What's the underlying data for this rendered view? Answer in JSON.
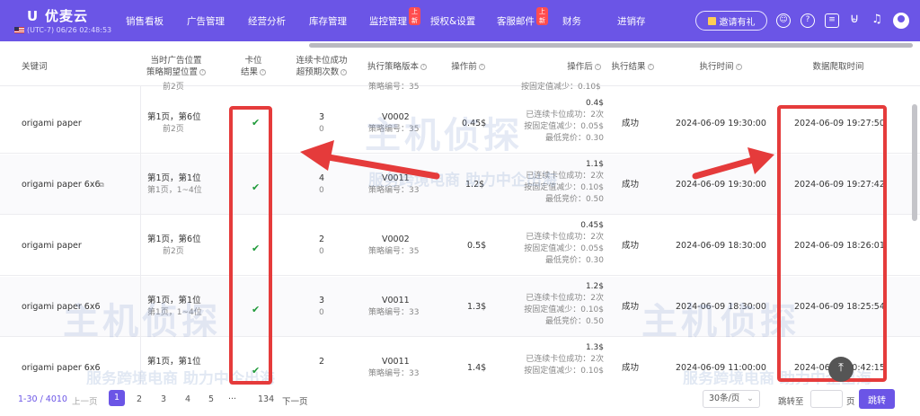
{
  "brand": {
    "name": "优麦云",
    "timezone": "(UTC-7) 06/26 02:48:53"
  },
  "nav": {
    "items": [
      "销售看板",
      "广告管理",
      "经营分析",
      "库存管理",
      "监控管理",
      "授权&设置",
      "客服邮件",
      "财务",
      "进销存"
    ],
    "badge_new": "上新"
  },
  "invite": "邀请有礼",
  "table": {
    "headers": {
      "keyword": "关键词",
      "position": [
        "当时广告位置",
        "策略期望位置"
      ],
      "slot": [
        "卡位",
        "结果"
      ],
      "consecutive": [
        "连续卡位成功",
        "超预期次数"
      ],
      "version": "执行策略版本",
      "before": "操作前",
      "after": "操作后",
      "result": "执行结果",
      "exec_time": "执行时间",
      "crawl_time": "数据爬取时间"
    },
    "partial_top": {
      "pos": "前2页",
      "strategy": "策略编号：35",
      "ops": "按固定值减少：0.10$"
    },
    "rows": [
      {
        "keyword": "origami paper",
        "pos1": "第1页，第6位",
        "pos2": "前2页",
        "slot": "✔",
        "c1": "3",
        "c2": "0",
        "version": "V0002",
        "strategy": "策略编号：35",
        "before": "0.45$",
        "after_top": "0.4$",
        "a1": "已连续卡位成功：2次",
        "a2": "按固定值减少：0.05$",
        "a3": "最低竞价：0.30",
        "result": "成功",
        "exec": "2024-06-09 19:30:00",
        "crawl": "2024-06-09 19:27:50"
      },
      {
        "keyword": "origami paper 6x6",
        "pos1": "第1页，第1位",
        "pos2": "第1页，1~4位",
        "slot": "✔",
        "c1": "4",
        "c2": "0",
        "version": "V0011",
        "strategy": "策略编号：33",
        "before": "1.2$",
        "after_top": "1.1$",
        "a1": "已连续卡位成功：2次",
        "a2": "按固定值减少：0.10$",
        "a3": "最低竞价：0.50",
        "result": "成功",
        "exec": "2024-06-09 19:30:00",
        "crawl": "2024-06-09 19:27:42"
      },
      {
        "keyword": "origami paper",
        "pos1": "第1页，第6位",
        "pos2": "前2页",
        "slot": "✔",
        "c1": "2",
        "c2": "0",
        "version": "V0002",
        "strategy": "策略编号：35",
        "before": "0.5$",
        "after_top": "0.45$",
        "a1": "已连续卡位成功：2次",
        "a2": "按固定值减少：0.05$",
        "a3": "最低竞价：0.30",
        "result": "成功",
        "exec": "2024-06-09 18:30:00",
        "crawl": "2024-06-09 18:26:01"
      },
      {
        "keyword": "origami paper 6x6",
        "pos1": "第1页，第1位",
        "pos2": "第1页，1~4位",
        "slot": "✔",
        "c1": "3",
        "c2": "0",
        "version": "V0011",
        "strategy": "策略编号：33",
        "before": "1.3$",
        "after_top": "1.2$",
        "a1": "已连续卡位成功：2次",
        "a2": "按固定值减少：0.10$",
        "a3": "最低竞价：0.50",
        "result": "成功",
        "exec": "2024-06-09 18:30:00",
        "crawl": "2024-06-09 18:25:54"
      },
      {
        "keyword": "origami paper 6x6",
        "pos1": "第1页，第1位",
        "pos2": "",
        "slot": "✔",
        "c1": "2",
        "c2": "",
        "version": "V0011",
        "strategy": "策略编号：33",
        "before": "1.4$",
        "after_top": "1.3$",
        "a1": "已连续卡位成功：2次",
        "a2": "按固定值减少：0.10$",
        "a3": "",
        "result": "成功",
        "exec": "2024-06-09 11:00:00",
        "crawl": "2024-06-09 10:42:15"
      }
    ]
  },
  "watermark": {
    "logo": "主机侦探",
    "slogan": "服务跨境电商 助力中企出海"
  },
  "pagination": {
    "range": "1-30 / 4010",
    "prev": "上一页",
    "pages": [
      "1",
      "2",
      "3",
      "4",
      "5",
      "···",
      "134"
    ],
    "next": "下一页",
    "page_size": "30条/页",
    "jump_label": "跳转至",
    "page_unit": "页",
    "jump_button": "跳转"
  },
  "colors": {
    "brand": "#6b55e6",
    "annotation": "#e53b3b",
    "success": "#1f9a3a"
  }
}
